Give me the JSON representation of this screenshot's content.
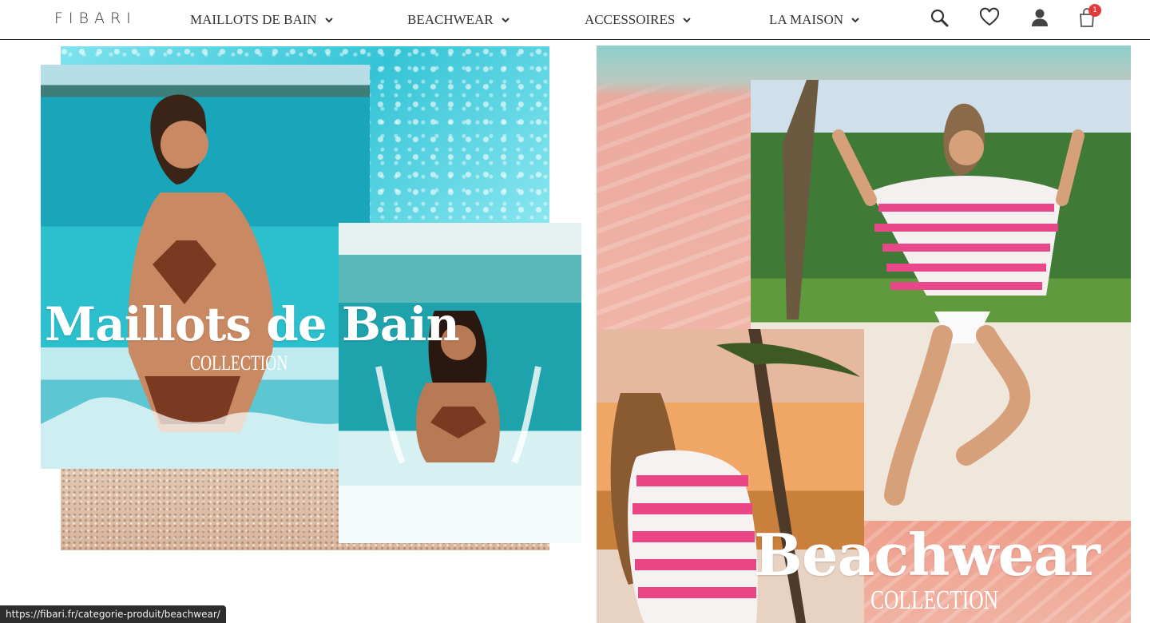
{
  "header": {
    "logo": "FIBARI",
    "nav": [
      {
        "label": "MAILLOTS DE BAIN",
        "icon": "chevron-down-icon"
      },
      {
        "label": "BEACHWEAR",
        "icon": "chevron-down-icon"
      },
      {
        "label": "ACCESSOIRES",
        "icon": "chevron-down-icon"
      },
      {
        "label": "LA MAISON",
        "icon": "chevron-down-icon"
      }
    ],
    "icons": {
      "search": "search-icon",
      "wishlist": "heart-icon",
      "account": "user-icon",
      "cart": "cart-icon"
    },
    "cart_count": "1"
  },
  "hero": {
    "left": {
      "title": "Maillots de Bain",
      "subtitle": "COLLECTION"
    },
    "right": {
      "title": "Beachwear",
      "subtitle": "COLLECTION"
    }
  },
  "status_bar": {
    "url": "https://fibari.fr/categorie-produit/beachwear/"
  },
  "colors": {
    "accent_badge": "#e23a3a",
    "header_text": "#333333",
    "status_bar_bg": "#2d2d2d"
  }
}
